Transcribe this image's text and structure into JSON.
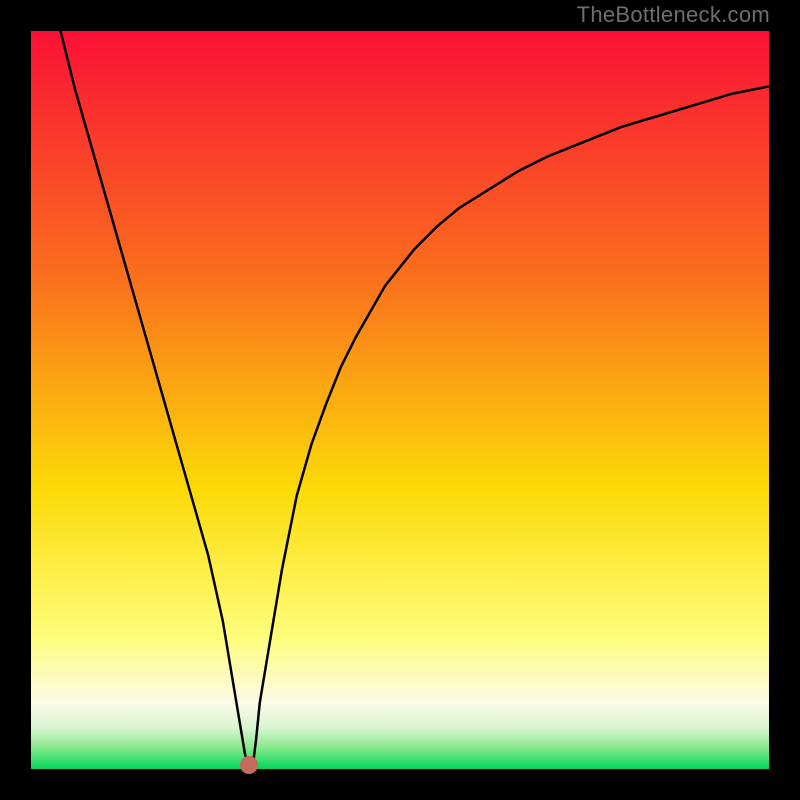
{
  "watermark": "TheBottleneck.com",
  "chart_data": {
    "type": "line",
    "title": "",
    "xlabel": "",
    "ylabel": "",
    "xlim": [
      0,
      100
    ],
    "ylim": [
      0,
      100
    ],
    "grid": false,
    "legend": false,
    "x": [
      4,
      6,
      8,
      10,
      12,
      14,
      16,
      18,
      20,
      22,
      24,
      26,
      27,
      28,
      28.5,
      29,
      29.4,
      29.5,
      30,
      30.5,
      31,
      32,
      33,
      34,
      35,
      36,
      38,
      40,
      42,
      44,
      46,
      48,
      50,
      52,
      55,
      58,
      62,
      66,
      70,
      75,
      80,
      85,
      90,
      95,
      100
    ],
    "values": [
      100,
      92,
      85,
      78,
      71,
      64,
      57,
      50,
      43,
      36,
      29,
      20,
      14,
      8,
      5,
      2,
      0.5,
      0,
      0,
      4,
      9,
      15,
      21,
      27,
      32,
      37,
      44,
      49.5,
      54.5,
      58.5,
      62,
      65.5,
      68,
      70.5,
      73.5,
      76,
      78.5,
      81,
      83,
      85,
      87,
      88.5,
      90,
      91.5,
      92.5
    ],
    "marker": {
      "x": 29.5,
      "y": 0.5
    },
    "colors": {
      "top": "#fa1135",
      "mid_upper": "#fa6e1d",
      "mid": "#fcda07",
      "mid_lower": "#fefd7a",
      "band1": "#fbfae7",
      "band2": "#d7f5d0",
      "band3": "#8be98e",
      "bottom": "#02d65a",
      "curve": "#000000",
      "marker": "#c76a5f",
      "watermark": "#6f6f6f"
    }
  }
}
